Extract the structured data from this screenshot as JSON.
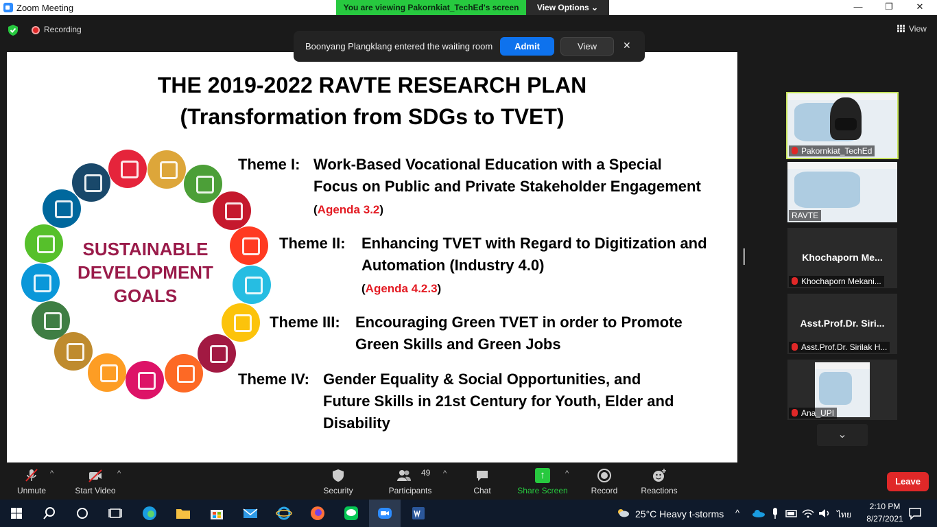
{
  "window": {
    "title": "Zoom Meeting",
    "viewing_banner": "You are viewing Pakornkiat_TechEd's screen",
    "view_options": "View Options ⌄",
    "minimize": "—",
    "restore": "❐",
    "close": "✕"
  },
  "topbar": {
    "recording": "Recording",
    "view": "View"
  },
  "waiting_room": {
    "message": "Boonyang Plangklang entered the waiting room",
    "admit": "Admit",
    "view": "View",
    "close": "✕"
  },
  "slide": {
    "title": "THE 2019-2022 RAVTE RESEARCH PLAN",
    "subtitle": "(Transformation from SDGs to TVET)",
    "sdg_label": [
      "SUSTAINABLE",
      "DEVELOPMENT",
      "GOALS"
    ],
    "themes": [
      {
        "label": "Theme I:",
        "lines": [
          "Work-Based Vocational Education with a Special",
          "Focus on Public and Private Stakeholder Engagement"
        ],
        "agenda": "Agenda 3.2"
      },
      {
        "label": "Theme II:",
        "lines": [
          "Enhancing TVET with Regard to Digitization and",
          "Automation (Industry 4.0)"
        ],
        "agenda": "Agenda 4.2.3"
      },
      {
        "label": "Theme III:",
        "lines": [
          "Encouraging Green TVET in order to Promote",
          "Green Skills and Green Jobs"
        ],
        "agenda": ""
      },
      {
        "label": "Theme IV:",
        "lines": [
          "Gender Equality & Social Opportunities, and",
          "Future Skills in 21st Century for Youth, Elder and",
          "Disability"
        ],
        "agenda": ""
      }
    ],
    "sdg_colors": [
      "#e5243b",
      "#dda63a",
      "#4c9f38",
      "#c5192d",
      "#ff3a21",
      "#26bde2",
      "#fcc30b",
      "#a21942",
      "#fd6925",
      "#dd1367",
      "#fd9d24",
      "#bf8b2e",
      "#3f7e44",
      "#0a97d9",
      "#56c02b",
      "#00689d",
      "#19486a"
    ]
  },
  "participants": [
    {
      "name": "Pakornkiat_TechEd",
      "type": "video"
    },
    {
      "name": "RAVTE",
      "type": "video"
    },
    {
      "name_big": "Khochaporn  Me...",
      "name": "Khochaporn Mekani...",
      "type": "name"
    },
    {
      "name_big": "Asst.Prof.Dr.  Siri...",
      "name": "Asst.Prof.Dr. Sirilak H...",
      "type": "name"
    },
    {
      "name": "Ana_UPI",
      "type": "video"
    }
  ],
  "participants_more": "⌄",
  "toolbar": {
    "unmute": "Unmute",
    "start_video": "Start Video",
    "security": "Security",
    "participants": "Participants",
    "participant_count": "49",
    "chat": "Chat",
    "share_screen": "Share Screen",
    "record": "Record",
    "reactions": "Reactions",
    "leave": "Leave",
    "caret": "^"
  },
  "taskbar": {
    "weather": "25°C  Heavy t-storms",
    "time": "2:10 PM",
    "date": "8/27/2021",
    "lang": "ไทย"
  }
}
